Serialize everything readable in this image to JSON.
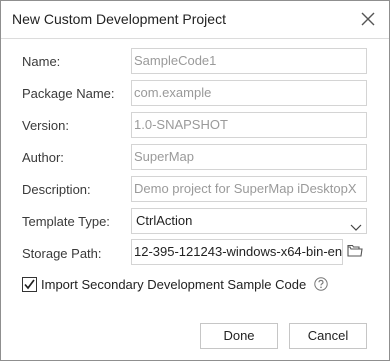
{
  "dialog": {
    "title": "New Custom Development Project"
  },
  "form": {
    "name_label": "Name:",
    "name_value": "SampleCode1",
    "package_label": "Package Name:",
    "package_value": "com.example",
    "version_label": "Version:",
    "version_value": "1.0-SNAPSHOT",
    "author_label": "Author:",
    "author_value": "SuperMap",
    "description_label": "Description:",
    "description_value": "Demo project for SuperMap iDesktopX",
    "template_label": "Template Type:",
    "template_value": "CtrlAction",
    "storage_label": "Storage Path:",
    "storage_value": "12-395-121243-windows-x64-bin-en"
  },
  "options": {
    "import_sample_label": "Import Secondary Development Sample Code",
    "import_sample_checked": true
  },
  "buttons": {
    "done_label": "Done",
    "cancel_label": "Cancel"
  },
  "icons": {
    "close": "close-icon",
    "dropdown": "chevron-down-icon",
    "browse": "folder-icon",
    "help": "help-icon",
    "check": "checkmark-icon"
  }
}
